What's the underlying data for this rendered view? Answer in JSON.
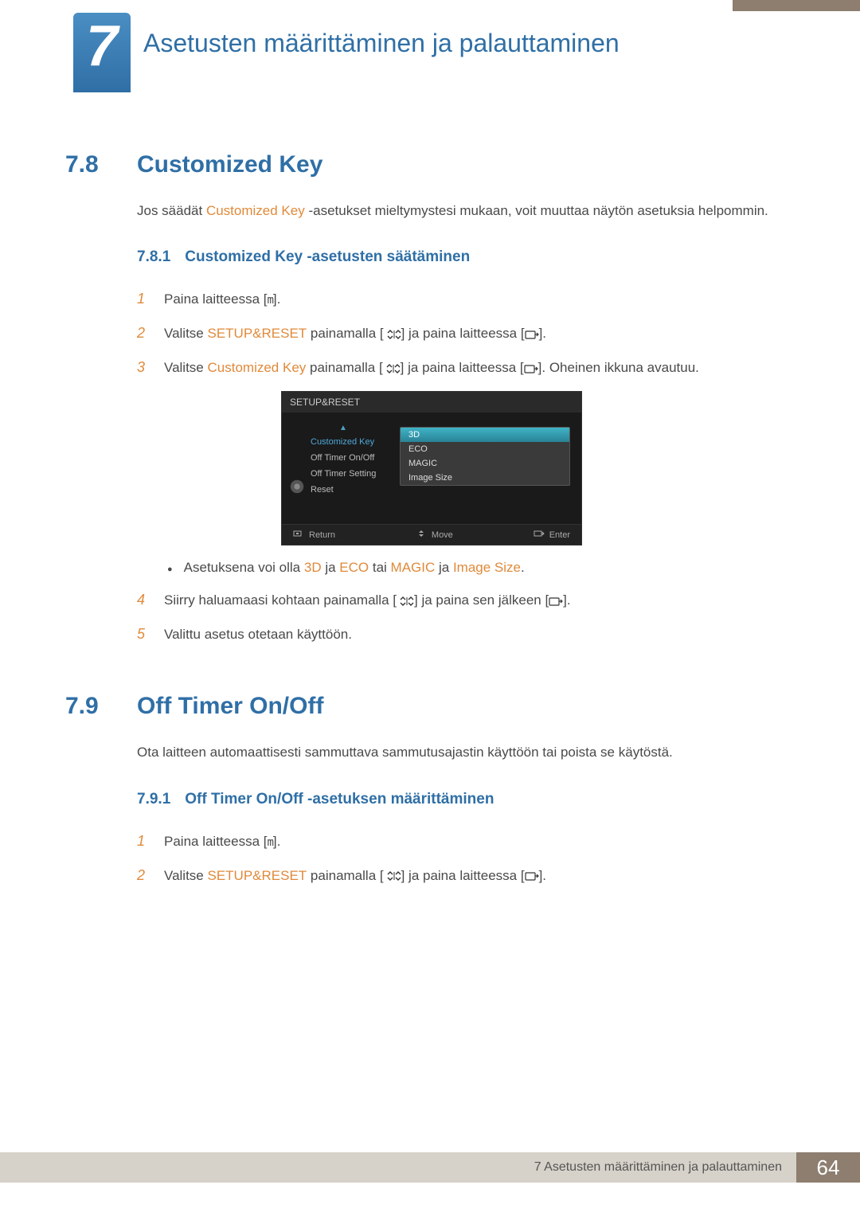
{
  "chapter": {
    "number": "7",
    "title": "Asetusten määrittäminen ja palauttaminen"
  },
  "section78": {
    "num": "7.8",
    "title": "Customized Key",
    "intro_a": "Jos säädät ",
    "intro_hl": "Customized Key",
    "intro_b": " -asetukset mieltymystesi mukaan, voit muuttaa näytön asetuksia helpommin.",
    "sub_num": "7.8.1",
    "sub_title": "Customized Key -asetusten säätäminen",
    "steps": {
      "s1": "Paina laitteessa [",
      "s1_icon": "m",
      "s1_end": "].",
      "s2_a": "Valitse ",
      "s2_hl": "SETUP&RESET",
      "s2_b": " painamalla [",
      "s2_c": "] ja paina laitteessa [",
      "s2_d": "].",
      "s3_a": "Valitse ",
      "s3_hl": "Customized Key",
      "s3_b": " painamalla [",
      "s3_c": "] ja paina laitteessa [",
      "s3_d": "]. Oheinen ikkuna avautuu.",
      "bullet_a": "Asetuksena voi olla ",
      "bullet_hl1": "3D",
      "bullet_b": " ja ",
      "bullet_hl2": "ECO",
      "bullet_c": " tai ",
      "bullet_hl3": "MAGIC",
      "bullet_d": " ja ",
      "bullet_hl4": "Image Size",
      "bullet_e": ".",
      "s4_a": "Siirry haluamaasi kohtaan painamalla [",
      "s4_b": "] ja paina sen jälkeen [",
      "s4_c": "].",
      "s5": "Valittu asetus otetaan käyttöön."
    }
  },
  "osd": {
    "header": "SETUP&RESET",
    "left_items": [
      "Customized Key",
      "Off Timer On/Off",
      "Off Timer Setting",
      "Reset"
    ],
    "right_items": [
      "3D",
      "ECO",
      "MAGIC",
      "Image Size"
    ],
    "footer": {
      "return": "Return",
      "move": "Move",
      "enter": "Enter"
    }
  },
  "section79": {
    "num": "7.9",
    "title": "Off Timer On/Off",
    "intro": "Ota laitteen automaattisesti sammuttava sammutusajastin käyttöön tai poista se käytöstä.",
    "sub_num": "7.9.1",
    "sub_title": "Off Timer On/Off -asetuksen määrittäminen",
    "steps": {
      "s1": "Paina laitteessa [",
      "s1_icon": "m",
      "s1_end": "].",
      "s2_a": "Valitse ",
      "s2_hl": "SETUP&RESET",
      "s2_b": " painamalla [",
      "s2_c": "] ja paina laitteessa [",
      "s2_d": "]."
    }
  },
  "footer": {
    "text": "7 Asetusten määrittäminen ja palauttaminen",
    "page": "64"
  }
}
